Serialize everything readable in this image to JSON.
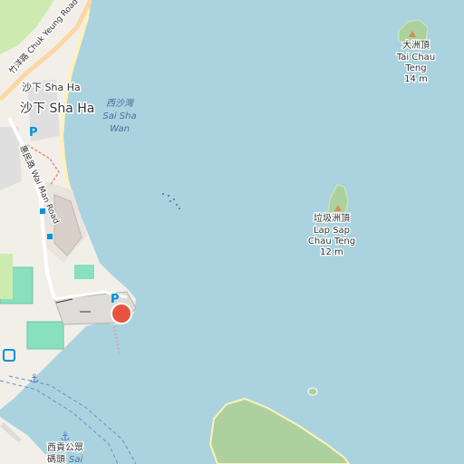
{
  "map": {
    "colors": {
      "water": "#aad3df",
      "land": "#f2efe9",
      "grass": "#cdebb0",
      "pitch": "#88e0be",
      "wood": "#add19e",
      "beach": "#fff1ba",
      "residential": "#e0dfdf",
      "marker": "#e8533f",
      "parking_blue": "#0092da"
    },
    "places": [
      {
        "id": "sha-ha-1",
        "text": "沙下 Sha Ha"
      },
      {
        "id": "sha-ha-2",
        "text": "沙下 Sha Ha"
      }
    ],
    "water_labels": {
      "chinese": "西沙灣",
      "line1": "Sai Sha",
      "line2": "Wan"
    },
    "roads": {
      "chuk_yeung": "竹洋路 Chuk Yeung Road",
      "wai_man": "惠民路 Wai Man Road"
    },
    "peaks": {
      "tai_chau": {
        "chinese": "大洲頂",
        "name1": "Tai Chau",
        "name2": "Teng",
        "elevation": "14 m"
      },
      "lap_sap": {
        "chinese": "垃圾洲頂",
        "name1": "Lap Sap",
        "name2": "Chau Teng",
        "elevation": "12 m"
      }
    },
    "pier": {
      "chinese": "西貢公眾",
      "chinese2": "碼頭",
      "partial": "Sai"
    },
    "parking_symbol": "P",
    "icons": [
      "parking-icon",
      "bus-stop-icon",
      "anchor-icon",
      "peak-triangle-icon",
      "location-marker-icon"
    ]
  }
}
